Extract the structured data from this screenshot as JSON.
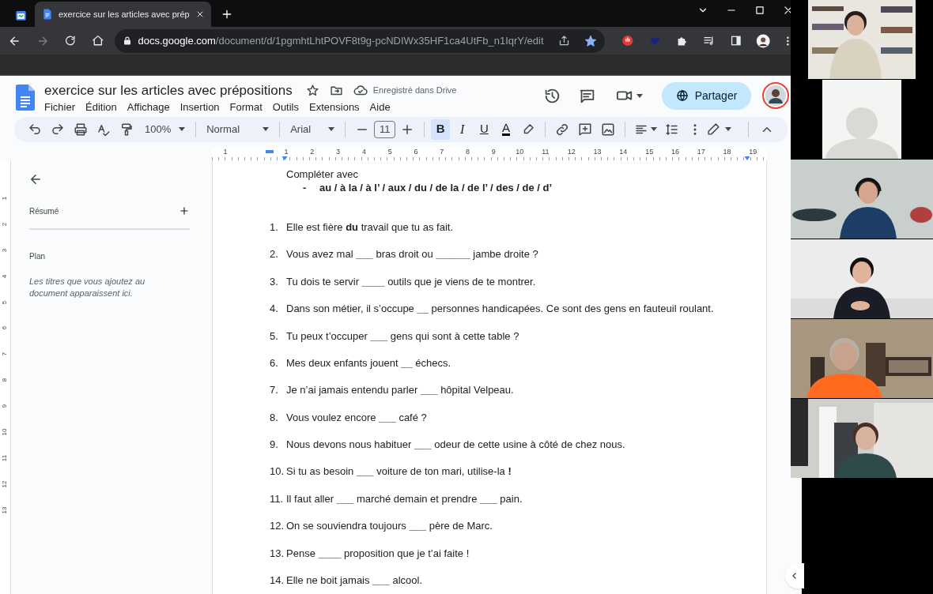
{
  "browser": {
    "tabs": [
      {
        "kind": "pinned",
        "selected": false
      },
      {
        "kind": "page",
        "title": "exercice sur les articles avec prép",
        "selected": true
      }
    ],
    "forward_button": {
      "disabled": true
    },
    "address": {
      "host": "docs.google.com",
      "path": "/document/d/1pgmhtLhtPOVF8t9g-pcNDIWx35HF1ca4UtFb_n1IqrY/edit",
      "starred": true
    }
  },
  "docs": {
    "title": "exercice sur les articles avec prépositions",
    "save_status": "Enregistré dans Drive",
    "menu": [
      "Fichier",
      "Édition",
      "Affichage",
      "Insertion",
      "Format",
      "Outils",
      "Extensions",
      "Aide"
    ],
    "share_button": "Partager",
    "toolbar": {
      "zoom": "100%",
      "style": "Normal",
      "font": "Arial",
      "font_size": "11",
      "format_buttons": [
        {
          "kind": "bold",
          "label": "B",
          "selected": true
        },
        {
          "kind": "italic",
          "label": "I",
          "selected": false
        },
        {
          "kind": "underline",
          "label": "U",
          "selected": false
        },
        {
          "kind": "text-color",
          "label": "A",
          "selected": false
        }
      ]
    },
    "ruler": [
      "1",
      "1",
      "2",
      "3",
      "4",
      "5",
      "6",
      "7",
      "8",
      "9",
      "10",
      "11",
      "12",
      "13",
      "14",
      "15",
      "16",
      "17",
      "18",
      "19"
    ],
    "left_ruler": [
      "1",
      "2",
      "3",
      "4",
      "5",
      "6",
      "7",
      "8",
      "9",
      "10",
      "11",
      "12",
      "13"
    ],
    "sidebar": {
      "summary": "Résumé",
      "outline": "Plan",
      "outline_hint": "Les titres que vous ajoutez au document apparaissent ici."
    },
    "document": {
      "instruction": "Compléter avec",
      "bullet": "-",
      "options": "au / à la / à l’ / aux / du / de la / de l’ / des / de / d’",
      "items": [
        {
          "number": "1.",
          "text": "Elle est fière **du** travail que tu as fait."
        },
        {
          "number": "2.",
          "text": "Vous avez mal **___** bras droit ou **______** jambe droite ?"
        },
        {
          "number": "3.",
          "text": "Tu dois te servir **____** outils que je viens de te montrer."
        },
        {
          "number": "4.",
          "text": "Dans son métier, il s’occupe **__** personnes handicapées. Ce sont des gens en fauteuil roulant."
        },
        {
          "number": "5.",
          "text": "Tu peux t’occuper **___** gens qui sont à cette table ?"
        },
        {
          "number": "6.",
          "text": "Mes deux enfants jouent **__** échecs."
        },
        {
          "number": "7.",
          "text": "Je n’ai jamais entendu parler **___** hôpital Velpeau."
        },
        {
          "number": "8.",
          "text": "Vous voulez encore **___** café ?"
        },
        {
          "number": "9.",
          "text": "Nous devons nous habituer **___** odeur de cette usine à côté de chez nous."
        },
        {
          "number": "10.",
          "text": "Si tu as besoin **___** voiture de ton mari, utilise-la **!**"
        },
        {
          "number": "11.",
          "text": "Il faut aller **___** marché demain et prendre **___** pain."
        },
        {
          "number": "12.",
          "text": "On se souviendra toujours **___** père de Marc."
        },
        {
          "number": "13.",
          "text": "Pense **____** proposition que je t’ai faite !"
        },
        {
          "number": "14.",
          "text": "Elle ne boit jamais **___** alcool."
        }
      ]
    }
  },
  "participants": [
    {
      "kind": "picture"
    },
    {
      "kind": "avatar"
    },
    {
      "kind": "picture"
    },
    {
      "kind": "picture"
    },
    {
      "kind": "picture"
    },
    {
      "kind": "picture"
    }
  ]
}
